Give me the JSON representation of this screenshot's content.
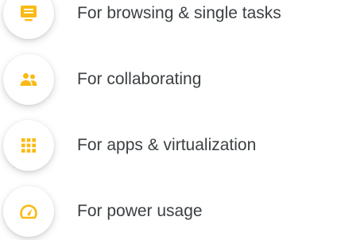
{
  "accent_color": "#F9BA15",
  "items": [
    {
      "icon": "monitor-icon",
      "label": "For browsing & single tasks"
    },
    {
      "icon": "people-icon",
      "label": "For collaborating"
    },
    {
      "icon": "apps-grid-icon",
      "label": "For apps & virtualization"
    },
    {
      "icon": "speedometer-icon",
      "label": "For power usage"
    }
  ]
}
